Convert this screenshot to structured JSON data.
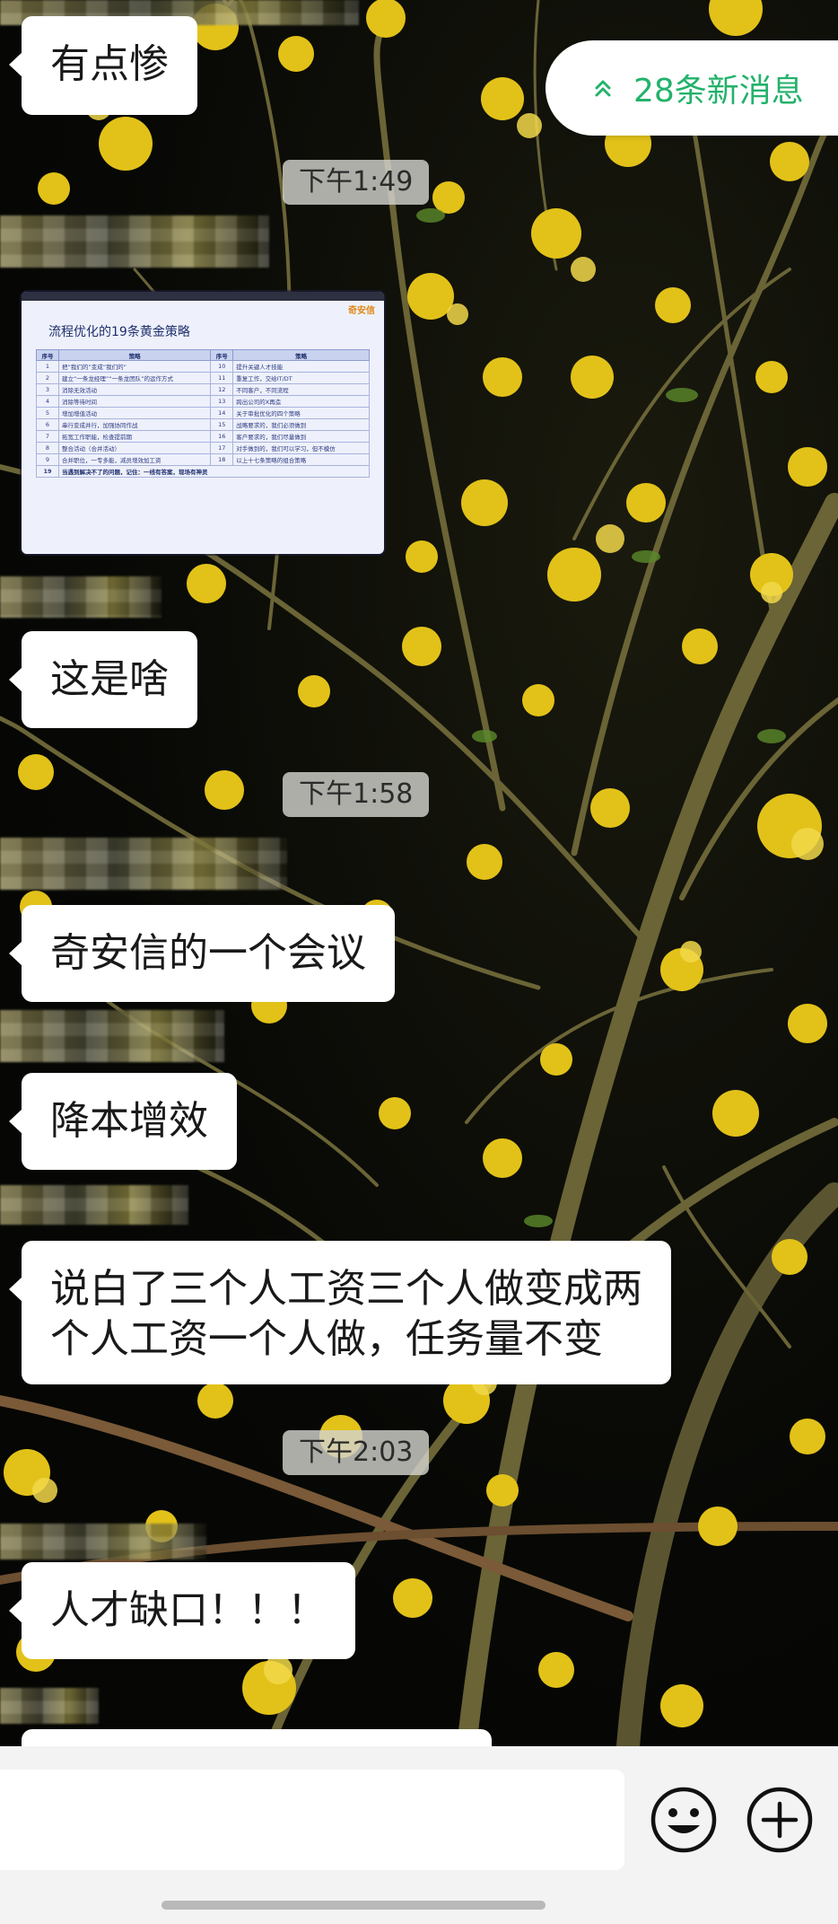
{
  "chat": {
    "new_messages": "28条新消息",
    "times": [
      "下午1:49",
      "下午1:58",
      "下午2:03"
    ],
    "messages": [
      "有点惨",
      "这是啥",
      "奇安信的一个会议",
      "降本增效",
      "说白了三个人工资三个人做变成两\n个人工资一个人做，任务量不变",
      "人才缺口！！！"
    ],
    "image_slide": {
      "title": "流程优化的19条黄金策略",
      "logo": "奇安信",
      "headers": [
        "序号",
        "策略",
        "序号",
        "策略"
      ],
      "rows": [
        [
          "1",
          "把“我们的”变成“我们的”",
          "10",
          "提升关键人才技能"
        ],
        [
          "2",
          "建立“一条龙经理”“一条龙团队”的运作方式",
          "11",
          "重复工作，交给IT/DT"
        ],
        [
          "3",
          "消除无效活动",
          "12",
          "不同客户，不同流程"
        ],
        [
          "4",
          "消除等待时间",
          "13",
          "跨出公司的X再造"
        ],
        [
          "5",
          "增加增值活动",
          "14",
          "关于审批优化的四个策略"
        ],
        [
          "6",
          "串行变成并行，加强协同作战",
          "15",
          "战略要求的，我们必须做到"
        ],
        [
          "7",
          "拓宽工作职能，检查提前期",
          "16",
          "客户要求的，我们尽量做到"
        ],
        [
          "8",
          "整合活动（合并活动）",
          "17",
          "对手做到的，我们可以学习，但不模仿"
        ],
        [
          "9",
          "合并职位，一专多能，减员增效加工资",
          "18",
          "以上十七条策略的组合策略"
        ]
      ],
      "footer_num": "19",
      "footer_text": "当遇到解决不了的问题，记住：一线有答案，现场有神灵"
    }
  },
  "input": {
    "emoji_icon": "smiley-icon",
    "plus_icon": "plus-circle-icon"
  },
  "colors": {
    "accent_green": "#23b26b",
    "bubble": "#ffffff",
    "input_bar": "#f3f3f3"
  }
}
